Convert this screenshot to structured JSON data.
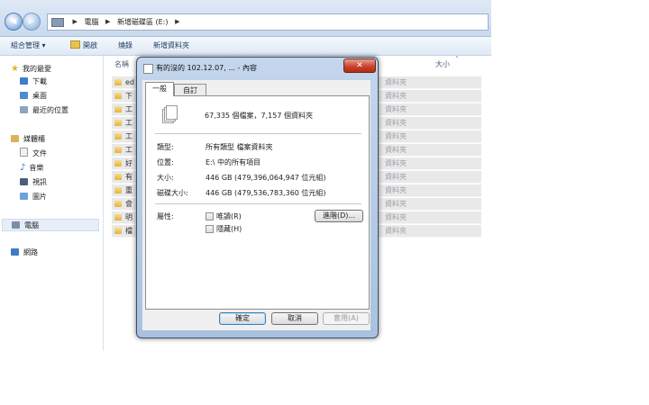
{
  "address_bar": {
    "back": "◀",
    "forward": "▶",
    "crumbs": [
      "電腦",
      "新增磁碟區 (E:)"
    ]
  },
  "toolbar": {
    "organize": "組合管理 ▾",
    "open": "開啟",
    "burn": "燒錄",
    "new_folder": "新增資料夾"
  },
  "sidebar": {
    "favorites": "我的最愛",
    "downloads": "下載",
    "desktop": "桌面",
    "recent": "最近的位置",
    "libraries": "媒體櫃",
    "documents": "文件",
    "music": "音樂",
    "videos": "視訊",
    "pictures": "圖片",
    "computer": "電腦",
    "network": "網路"
  },
  "file_list": {
    "col_name": "名稱",
    "col_size": "大小",
    "rows": [
      {
        "name": "ed",
        "type": "資料夾"
      },
      {
        "name": "下",
        "type": "資料夾"
      },
      {
        "name": "工",
        "type": "資料夾"
      },
      {
        "name": "工",
        "type": "資料夾"
      },
      {
        "name": "工",
        "type": "資料夾"
      },
      {
        "name": "工",
        "type": "資料夾"
      },
      {
        "name": "好",
        "type": "資料夾"
      },
      {
        "name": "有",
        "type": "資料夾"
      },
      {
        "name": "重",
        "type": "資料夾"
      },
      {
        "name": "會",
        "type": "資料夾"
      },
      {
        "name": "明",
        "type": "資料夾"
      },
      {
        "name": "檔",
        "type": "資料夾"
      }
    ]
  },
  "dialog": {
    "title": "有的沒的 102.12.07, ... - 內容",
    "close": "✕",
    "tabs": {
      "general": "一般",
      "custom": "自訂"
    },
    "summary": "67,335 個檔案，7,157 個資料夾",
    "type_label": "類型:",
    "type_value": "所有類型 檔案資料夾",
    "location_label": "位置:",
    "location_value": "E:\\ 中的所有項目",
    "size_label": "大小:",
    "size_value": "446 GB (479,396,064,947 位元組)",
    "disk_size_label": "磁碟大小:",
    "disk_size_value": "446 GB (479,536,783,360 位元組)",
    "attributes_label": "屬性:",
    "readonly": "唯讀(R)",
    "hidden": "隱藏(H)",
    "advanced": "進階(D)...",
    "ok": "確定",
    "cancel": "取消",
    "apply": "套用(A)"
  },
  "colors": {
    "title_bar": "#bcd2ec",
    "close_button": "#c9452e",
    "folder": "#e8c45a"
  }
}
